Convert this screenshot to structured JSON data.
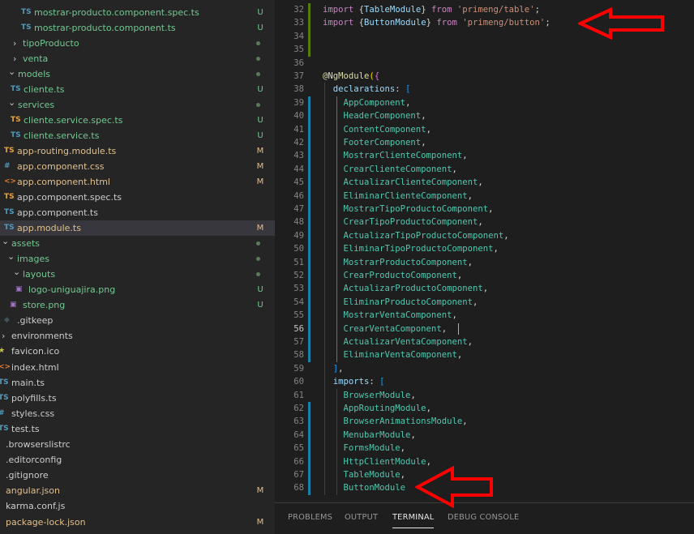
{
  "explorer": {
    "items": [
      {
        "label": "mostrar-producto.component.spec.ts",
        "icon": "ts-icon",
        "git": "U",
        "color": "#73c991"
      },
      {
        "label": "mostrar-producto.component.ts",
        "icon": "ts-icon",
        "git": "U",
        "color": "#73c991"
      },
      {
        "label": "tipoProducto",
        "icon": "folder",
        "git": "dot",
        "color": "#73c991"
      },
      {
        "label": "venta",
        "icon": "folder",
        "git": "dot",
        "color": "#73c991"
      },
      {
        "label": "models",
        "icon": "folder-open",
        "git": "dot",
        "color": "#73c991"
      },
      {
        "label": "cliente.ts",
        "icon": "ts-icon",
        "git": "U",
        "color": "#73c991"
      },
      {
        "label": "services",
        "icon": "folder-open",
        "git": "dot",
        "color": "#73c991"
      },
      {
        "label": "cliente.service.spec.ts",
        "icon": "ts-spec-icon",
        "git": "U",
        "color": "#73c991"
      },
      {
        "label": "cliente.service.ts",
        "icon": "ts-icon",
        "git": "U",
        "color": "#73c991"
      },
      {
        "label": "app-routing.module.ts",
        "icon": "ts-spec-icon",
        "git": "M",
        "color": "#e2c08d"
      },
      {
        "label": "app.component.css",
        "icon": "css-icon",
        "git": "M",
        "color": "#e2c08d"
      },
      {
        "label": "app.component.html",
        "icon": "html-icon",
        "git": "M",
        "color": "#e2c08d"
      },
      {
        "label": "app.component.spec.ts",
        "icon": "ts-spec-icon",
        "git": "",
        "color": "#cccccc"
      },
      {
        "label": "app.component.ts",
        "icon": "ts-icon",
        "git": "",
        "color": "#cccccc"
      },
      {
        "label": "app.module.ts",
        "icon": "ts-icon",
        "git": "M",
        "color": "#e2c08d"
      },
      {
        "label": "assets",
        "icon": "folder-open",
        "git": "dot",
        "color": "#73c991"
      },
      {
        "label": "images",
        "icon": "folder-open",
        "git": "dot",
        "color": "#73c991"
      },
      {
        "label": "layouts",
        "icon": "folder-open",
        "git": "dot",
        "color": "#73c991"
      },
      {
        "label": "logo-uniguajira.png",
        "icon": "image-icon",
        "git": "U",
        "color": "#73c991"
      },
      {
        "label": "store.png",
        "icon": "image-icon",
        "git": "U",
        "color": "#73c991"
      },
      {
        "label": ".gitkeep",
        "icon": "gitkeep-icon",
        "git": "",
        "color": "#cccccc"
      },
      {
        "label": "environments",
        "icon": "folder",
        "git": "",
        "color": "#cccccc"
      },
      {
        "label": "favicon.ico",
        "icon": "star-icon",
        "git": "",
        "color": "#cccccc"
      },
      {
        "label": "index.html",
        "icon": "html-icon",
        "git": "",
        "color": "#cccccc"
      },
      {
        "label": "main.ts",
        "icon": "ts-icon",
        "git": "",
        "color": "#cccccc"
      },
      {
        "label": "polyfills.ts",
        "icon": "ts-icon",
        "git": "",
        "color": "#cccccc"
      },
      {
        "label": "styles.css",
        "icon": "css-icon",
        "git": "",
        "color": "#cccccc"
      },
      {
        "label": "test.ts",
        "icon": "ts-icon",
        "git": "",
        "color": "#cccccc"
      },
      {
        "label": ".browserslistrc",
        "icon": "none",
        "git": "",
        "color": "#cccccc"
      },
      {
        "label": ".editorconfig",
        "icon": "none",
        "git": "",
        "color": "#cccccc"
      },
      {
        "label": ".gitignore",
        "icon": "none",
        "git": "",
        "color": "#cccccc"
      },
      {
        "label": "angular.json",
        "icon": "none",
        "git": "M",
        "color": "#e2c08d"
      },
      {
        "label": "karma.conf.js",
        "icon": "none",
        "git": "",
        "color": "#cccccc"
      },
      {
        "label": "package-lock.json",
        "icon": "none",
        "git": "M",
        "color": "#e2c08d"
      }
    ]
  },
  "editor": {
    "current_line": "56",
    "lines": [
      {
        "n": "32",
        "tokens": [
          [
            "import",
            "c-kw"
          ],
          [
            " {",
            "c-pun"
          ],
          [
            "TableModule",
            "c-var"
          ],
          [
            "} ",
            "c-pun"
          ],
          [
            "from",
            "c-kw"
          ],
          [
            " ",
            "c-pun"
          ],
          [
            "'primeng/table'",
            "c-str"
          ],
          [
            ";",
            "c-pun"
          ]
        ]
      },
      {
        "n": "33",
        "tokens": [
          [
            "import",
            "c-kw"
          ],
          [
            " {",
            "c-pun"
          ],
          [
            "ButtonModule",
            "c-var"
          ],
          [
            "} ",
            "c-pun"
          ],
          [
            "from",
            "c-kw"
          ],
          [
            " ",
            "c-pun"
          ],
          [
            "'primeng/button'",
            "c-str"
          ],
          [
            ";",
            "c-pun"
          ]
        ]
      },
      {
        "n": "34",
        "tokens": []
      },
      {
        "n": "35",
        "tokens": []
      },
      {
        "n": "36",
        "tokens": []
      },
      {
        "n": "37",
        "tokens": [
          [
            "@",
            "c-dec"
          ],
          [
            "NgModule",
            "c-dec"
          ],
          [
            "(",
            "c-br3"
          ],
          [
            "{",
            "c-br1"
          ]
        ]
      },
      {
        "n": "38",
        "tokens": [
          [
            "  declarations",
            "c-var"
          ],
          [
            ": ",
            "c-pun"
          ],
          [
            "[",
            "c-br2"
          ]
        ]
      },
      {
        "n": "39",
        "tokens": [
          [
            "    AppComponent",
            "c-cls"
          ],
          [
            ",",
            "c-pun"
          ]
        ]
      },
      {
        "n": "40",
        "tokens": [
          [
            "    HeaderComponent",
            "c-cls"
          ],
          [
            ",",
            "c-pun"
          ]
        ]
      },
      {
        "n": "41",
        "tokens": [
          [
            "    ContentComponent",
            "c-cls"
          ],
          [
            ",",
            "c-pun"
          ]
        ]
      },
      {
        "n": "42",
        "tokens": [
          [
            "    FooterComponent",
            "c-cls"
          ],
          [
            ",",
            "c-pun"
          ]
        ]
      },
      {
        "n": "43",
        "tokens": [
          [
            "    MostrarClienteComponent",
            "c-cls"
          ],
          [
            ",",
            "c-pun"
          ]
        ]
      },
      {
        "n": "44",
        "tokens": [
          [
            "    CrearClienteComponent",
            "c-cls"
          ],
          [
            ",",
            "c-pun"
          ]
        ]
      },
      {
        "n": "45",
        "tokens": [
          [
            "    ActualizarClienteComponent",
            "c-cls"
          ],
          [
            ",",
            "c-pun"
          ]
        ]
      },
      {
        "n": "46",
        "tokens": [
          [
            "    EliminarClienteComponent",
            "c-cls"
          ],
          [
            ",",
            "c-pun"
          ]
        ]
      },
      {
        "n": "47",
        "tokens": [
          [
            "    MostrarTipoProductoComponent",
            "c-cls"
          ],
          [
            ",",
            "c-pun"
          ]
        ]
      },
      {
        "n": "48",
        "tokens": [
          [
            "    CrearTipoProductoComponent",
            "c-cls"
          ],
          [
            ",",
            "c-pun"
          ]
        ]
      },
      {
        "n": "49",
        "tokens": [
          [
            "    ActualizarTipoProductoComponent",
            "c-cls"
          ],
          [
            ",",
            "c-pun"
          ]
        ]
      },
      {
        "n": "50",
        "tokens": [
          [
            "    EliminarTipoProductoComponent",
            "c-cls"
          ],
          [
            ",",
            "c-pun"
          ]
        ]
      },
      {
        "n": "51",
        "tokens": [
          [
            "    MostrarProductoComponent",
            "c-cls"
          ],
          [
            ",",
            "c-pun"
          ]
        ]
      },
      {
        "n": "52",
        "tokens": [
          [
            "    CrearProductoComponent",
            "c-cls"
          ],
          [
            ",",
            "c-pun"
          ]
        ]
      },
      {
        "n": "53",
        "tokens": [
          [
            "    ActualizarProductoComponent",
            "c-cls"
          ],
          [
            ",",
            "c-pun"
          ]
        ]
      },
      {
        "n": "54",
        "tokens": [
          [
            "    EliminarProductoComponent",
            "c-cls"
          ],
          [
            ",",
            "c-pun"
          ]
        ]
      },
      {
        "n": "55",
        "tokens": [
          [
            "    MostrarVentaComponent",
            "c-cls"
          ],
          [
            ",",
            "c-pun"
          ]
        ]
      },
      {
        "n": "56",
        "tokens": [
          [
            "    CrearVentaComponent",
            "c-cls"
          ],
          [
            ",",
            "c-pun"
          ]
        ]
      },
      {
        "n": "57",
        "tokens": [
          [
            "    ActualizarVentaComponent",
            "c-cls"
          ],
          [
            ",",
            "c-pun"
          ]
        ]
      },
      {
        "n": "58",
        "tokens": [
          [
            "    EliminarVentaComponent",
            "c-cls"
          ],
          [
            ",",
            "c-pun"
          ]
        ]
      },
      {
        "n": "59",
        "tokens": [
          [
            "  ]",
            "c-br2"
          ],
          [
            ",",
            "c-pun"
          ]
        ]
      },
      {
        "n": "60",
        "tokens": [
          [
            "  imports",
            "c-var"
          ],
          [
            ": ",
            "c-pun"
          ],
          [
            "[",
            "c-br2"
          ]
        ]
      },
      {
        "n": "61",
        "tokens": [
          [
            "    BrowserModule",
            "c-cls"
          ],
          [
            ",",
            "c-pun"
          ]
        ]
      },
      {
        "n": "62",
        "tokens": [
          [
            "    AppRoutingModule",
            "c-cls"
          ],
          [
            ",",
            "c-pun"
          ]
        ]
      },
      {
        "n": "63",
        "tokens": [
          [
            "    BrowserAnimationsModule",
            "c-cls"
          ],
          [
            ",",
            "c-pun"
          ]
        ]
      },
      {
        "n": "64",
        "tokens": [
          [
            "    MenubarModule",
            "c-cls"
          ],
          [
            ",",
            "c-pun"
          ]
        ]
      },
      {
        "n": "65",
        "tokens": [
          [
            "    FormsModule",
            "c-cls"
          ],
          [
            ",",
            "c-pun"
          ]
        ]
      },
      {
        "n": "66",
        "tokens": [
          [
            "    HttpClientModule",
            "c-cls"
          ],
          [
            ",",
            "c-pun"
          ]
        ]
      },
      {
        "n": "67",
        "tokens": [
          [
            "    TableModule",
            "c-cls"
          ],
          [
            ",",
            "c-pun"
          ]
        ]
      },
      {
        "n": "68",
        "tokens": [
          [
            "    ButtonModule",
            "c-cls"
          ]
        ]
      }
    ]
  },
  "panel": {
    "tabs": [
      "PROBLEMS",
      "OUTPUT",
      "TERMINAL",
      "DEBUG CONSOLE"
    ],
    "active_tab": "TERMINAL"
  },
  "colors": {
    "sidebar_bg": "#252526",
    "editor_bg": "#1e1e1e",
    "selection": "#37373d",
    "untracked": "#73c991",
    "modified": "#e2c08d",
    "annotation_arrow": "#ff0000"
  }
}
